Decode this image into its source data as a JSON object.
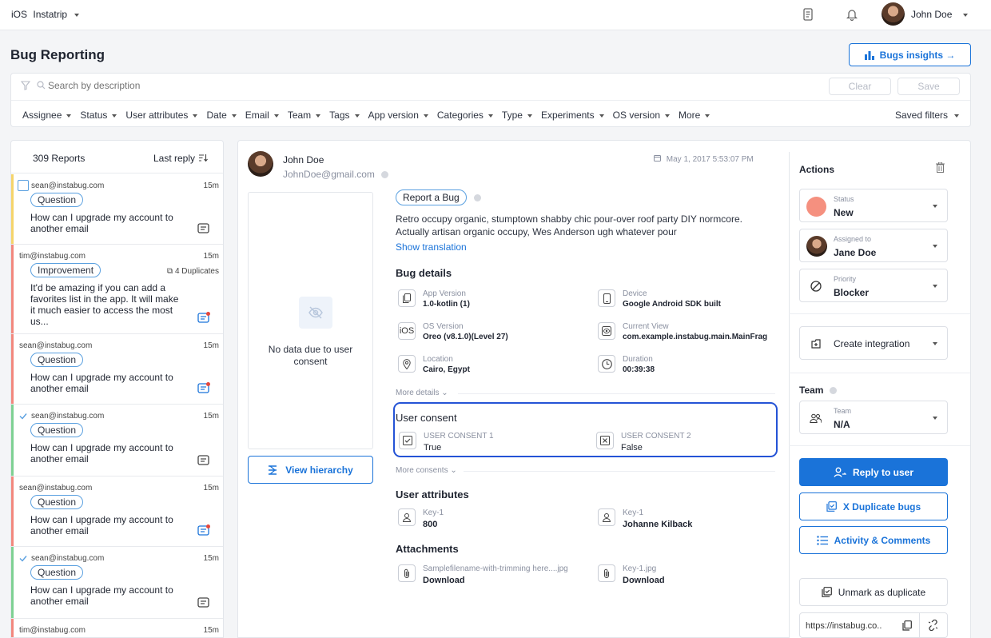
{
  "topbar": {
    "platform": "iOS",
    "app_name": "Instatrip",
    "user_name": "John Doe"
  },
  "header": {
    "title": "Bug Reporting",
    "insights_label": "Bugs insights →"
  },
  "search": {
    "placeholder": "Search by description",
    "clear_label": "Clear",
    "save_label": "Save"
  },
  "filters": {
    "items": [
      "Assignee",
      "Status",
      "User attributes",
      "Date",
      "Email",
      "Team",
      "Tags",
      "App version",
      "Categories",
      "Type",
      "Experiments",
      "OS version",
      "More"
    ],
    "saved_label": "Saved filters"
  },
  "list": {
    "count_label": "309 Reports",
    "sort_label": "Last reply",
    "reports": [
      {
        "email": "sean@instabug.com",
        "time": "15m",
        "tag": "Question",
        "text": "How can I upgrade my account to another email",
        "dups": "",
        "bar_color": "#f5d46a",
        "checked": false
      },
      {
        "email": "tim@instabug.com",
        "time": "15m",
        "tag": "Improvement",
        "text": "It'd be amazing if you can add a favorites list in the app. It will make it much easier to access the most us...",
        "dups": "4 Duplicates",
        "bar_color": "#f2877d",
        "checked": false
      },
      {
        "email": "sean@instabug.com",
        "time": "15m",
        "tag": "Question",
        "text": "How can I upgrade my account to another email",
        "dups": "",
        "bar_color": "#f2877d",
        "checked": false
      },
      {
        "email": "sean@instabug.com",
        "time": "15m",
        "tag": "Question",
        "text": "How can I upgrade my account to another email",
        "dups": "",
        "bar_color": "#7ed093",
        "checked": true
      },
      {
        "email": "sean@instabug.com",
        "time": "15m",
        "tag": "Question",
        "text": "How can I upgrade my account to another email",
        "dups": "",
        "bar_color": "#f2877d",
        "checked": false
      },
      {
        "email": "sean@instabug.com",
        "time": "15m",
        "tag": "Question",
        "text": "How can I upgrade my account to another email",
        "dups": "",
        "bar_color": "#7ed093",
        "checked": true
      },
      {
        "email": "tim@instabug.com",
        "time": "15m",
        "tag": "",
        "text": "",
        "dups": "",
        "bar_color": "#f2877d",
        "checked": false
      }
    ]
  },
  "detail": {
    "reporter_name": "John Doe",
    "reporter_email": "JohnDoe@gmail.com",
    "date": "May 1, 2017 5:53:07 PM",
    "no_data": "No data due to user consent",
    "view_hierarchy": "View hierarchy",
    "report_tag": "Report a Bug",
    "description": "Retro occupy organic, stumptown shabby chic pour-over roof party DIY normcore. Actually artisan organic occupy, Wes Anderson ugh whatever pour",
    "show_translation": "Show translation",
    "bug_details_title": "Bug details",
    "bug_details": [
      {
        "icon": "file-icon",
        "label": "App Version",
        "value": "1.0-kotlin (1)"
      },
      {
        "icon": "device-icon",
        "label": "Device",
        "value": "Google Android SDK built"
      },
      {
        "icon": "ios-icon",
        "label": "OS Version",
        "value": "Oreo (v8.1.0)(Level 27)"
      },
      {
        "icon": "eye-icon",
        "label": "Current View",
        "value": "com.example.instabug.main.MainFrag"
      },
      {
        "icon": "location-icon",
        "label": "Location",
        "value": "Cairo, Egypt"
      },
      {
        "icon": "clock-icon",
        "label": "Duration",
        "value": "00:39:38"
      }
    ],
    "more_details": "More details",
    "consent_title": "User consent",
    "consents": [
      {
        "label": "USER CONSENT 1",
        "value": "True"
      },
      {
        "label": "USER CONSENT 2",
        "value": "False"
      }
    ],
    "more_consents": "More consents",
    "attributes_title": "User attributes",
    "attributes": [
      {
        "label": "Key-1",
        "value": "800"
      },
      {
        "label": "Key-1",
        "value": "Johanne Kilback"
      }
    ],
    "attachments_title": "Attachments",
    "attachments": [
      {
        "label": "Samplefilename-with-trimming here....jpg",
        "value": "Download"
      },
      {
        "label": "Key-1.jpg",
        "value": "Download"
      }
    ]
  },
  "actions": {
    "title": "Actions",
    "status_label": "Status",
    "status_value": "New",
    "status_color": "#f5907f",
    "assigned_label": "Assigned to",
    "assigned_value": "Jane Doe",
    "priority_label": "Priority",
    "priority_value": "Blocker",
    "create_integration": "Create integration",
    "team_section": "Team",
    "team_label": "Team",
    "team_value": "N/A",
    "reply": "Reply to user",
    "duplicate": "X Duplicate bugs",
    "activity": "Activity & Comments",
    "unmark": "Unmark as duplicate",
    "link": "https://instabug.co.."
  },
  "colors": {
    "accent": "#1a73d9",
    "primary_button": "#1a73d9"
  }
}
